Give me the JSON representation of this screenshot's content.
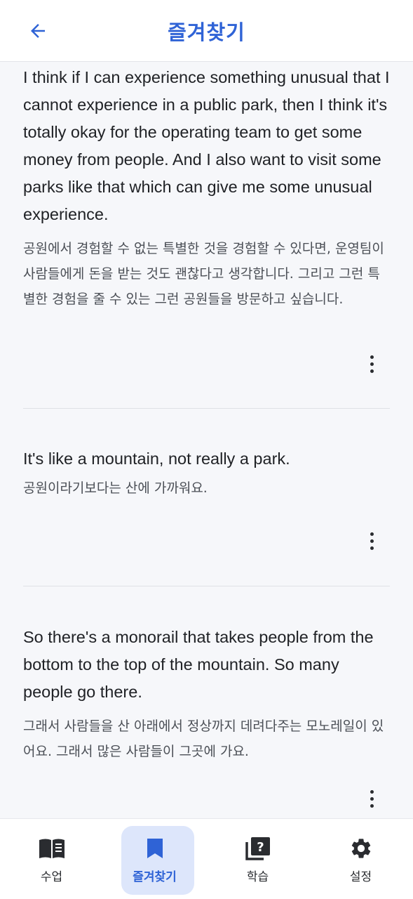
{
  "header": {
    "title": "즐겨찾기",
    "back_icon": "arrow-left-icon"
  },
  "favorites": [
    {
      "english": "I think if I can experience something unusual that I cannot experience in a public park, then I think it's totally okay for the operating team to get some money from people. And I also want to visit some parks like that which can give me some unusual experience.",
      "korean": "공원에서 경험할 수 없는 특별한 것을 경험할 수 있다면, 운영팀이 사람들에게 돈을 받는 것도 괜찮다고 생각합니다. 그리고 그런 특별한 경험을 줄 수 있는 그런 공원들을 방문하고 싶습니다."
    },
    {
      "english": "It's like a mountain, not really a park.",
      "korean": "공원이라기보다는 산에 가까워요."
    },
    {
      "english": "So there's a monorail that takes people from the bottom to the top of the mountain. So many people go there.",
      "korean": "그래서 사람들을 산 아래에서 정상까지 데려다주는 모노레일이 있어요. 그래서 많은 사람들이 그곳에 가요."
    }
  ],
  "bottom_nav": [
    {
      "label": "수업",
      "icon": "book-icon",
      "active": false
    },
    {
      "label": "즐겨찾기",
      "icon": "bookmark-icon",
      "active": true
    },
    {
      "label": "학습",
      "icon": "quiz-icon",
      "active": false
    },
    {
      "label": "설정",
      "icon": "gear-icon",
      "active": false
    }
  ],
  "colors": {
    "accent": "#2f63d6",
    "active_pill": "#dde6fb",
    "background": "#f6f7fa"
  }
}
